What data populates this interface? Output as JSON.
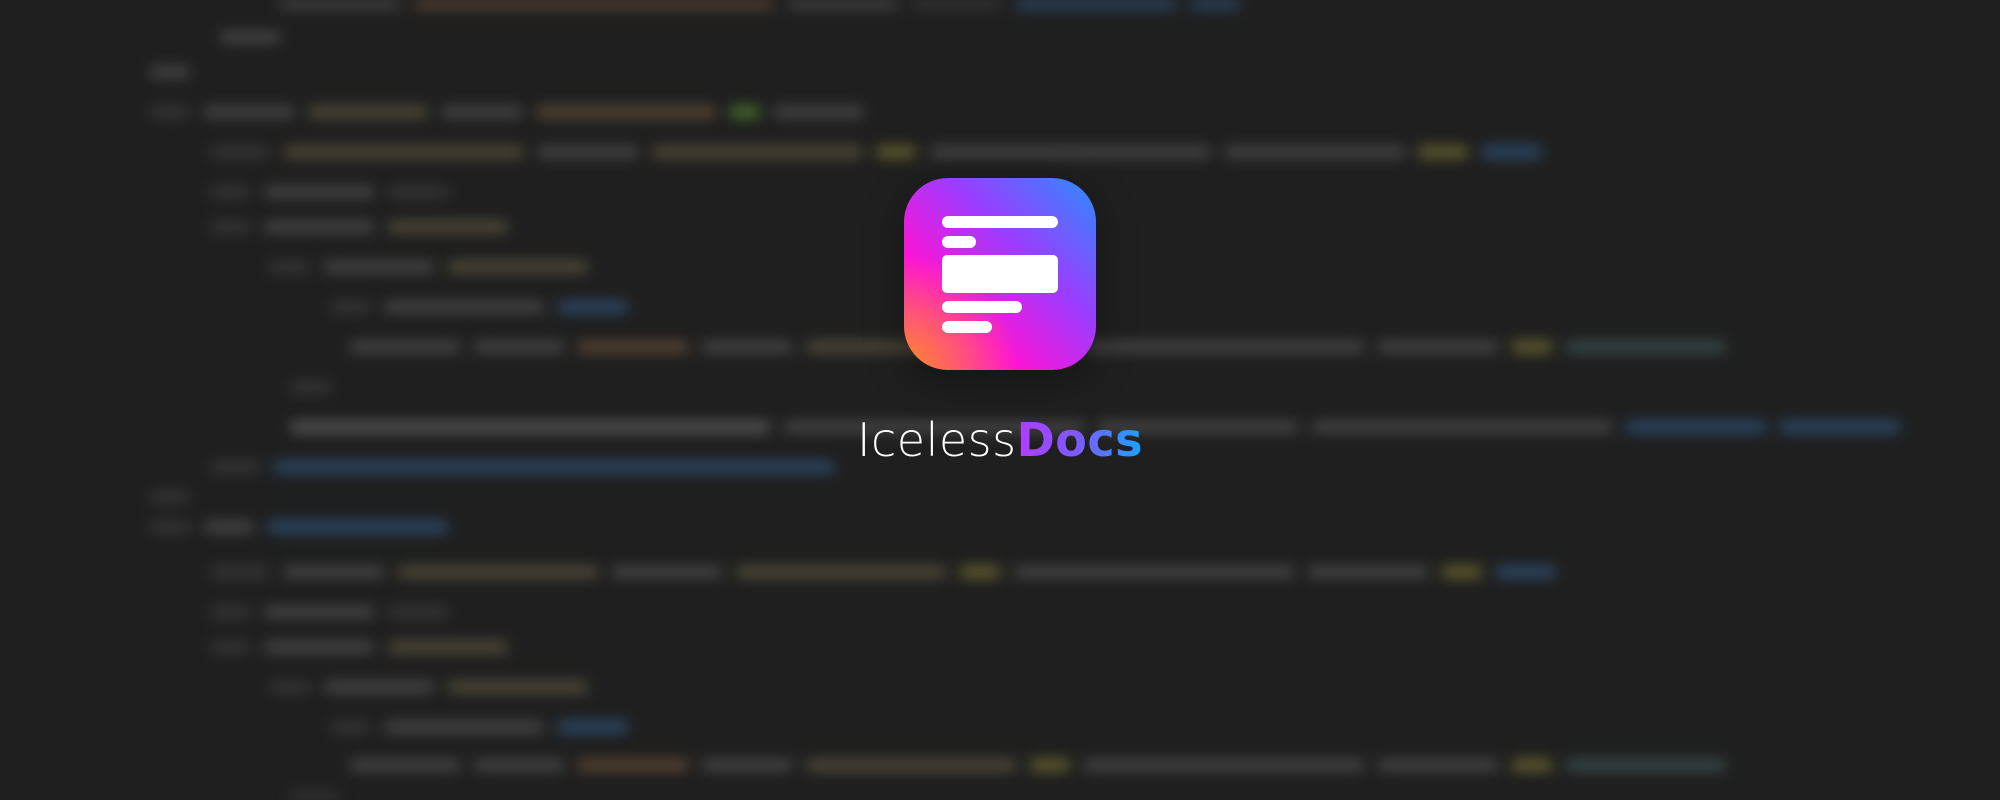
{
  "app": {
    "logo_icon": "document-icon",
    "brand_primary": "Iceless",
    "brand_accent": "Docs"
  },
  "colors": {
    "background": "#1f1f1f",
    "gradient_orange": "#ff8a2a",
    "gradient_magenta": "#ff13d6",
    "gradient_purple": "#9b3dff",
    "gradient_blue": "#2a8dff"
  }
}
